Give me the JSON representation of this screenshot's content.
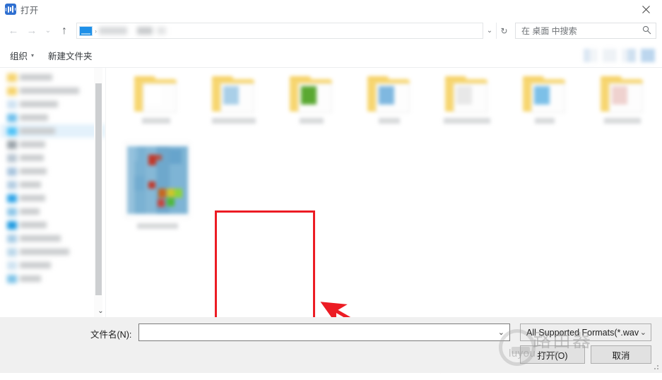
{
  "window": {
    "title": "打开",
    "app_icon": "audio-waveform-icon",
    "close_label": "✕"
  },
  "nav": {
    "back_icon": "arrow-left-icon",
    "forward_icon": "arrow-right-icon",
    "recent_icon": "chevron-down-icon",
    "up_icon": "arrow-up-icon",
    "breadcrumb_icon": "desktop-monitor-icon",
    "breadcrumb_separator": "›",
    "path_dropdown_icon": "chevron-down-icon",
    "refresh_icon": "↻",
    "search": {
      "placeholder": "在 桌面 中搜索",
      "icon": "search-icon"
    }
  },
  "command_bar": {
    "organize_label": "组织",
    "organize_caret": "▾",
    "new_folder_label": "新建文件夹",
    "view_buttons": [
      "view-mode-button-1",
      "view-mode-button-2",
      "view-mode-button-3",
      "help-button"
    ]
  },
  "sidebar": {
    "scroll_down_icon": "chevron-down-icon",
    "items": [
      {
        "icon_color": "#f6d36b",
        "label_width": 46,
        "selected": false
      },
      {
        "icon_color": "#f6d36b",
        "label_width": 84,
        "selected": false
      },
      {
        "icon_color": "#cfe2f2",
        "label_width": 54,
        "selected": false
      },
      {
        "icon_color": "#6fc0ec",
        "label_width": 40,
        "selected": false
      },
      {
        "icon_color": "#4fc3f7",
        "label_width": 50,
        "selected": true
      },
      {
        "icon_color": "#9aa3aa",
        "label_width": 36,
        "selected": false
      },
      {
        "icon_color": "#b9c6d2",
        "label_width": 34,
        "selected": false
      },
      {
        "icon_color": "#a8c4dd",
        "label_width": 38,
        "selected": false
      },
      {
        "icon_color": "#b4cde2",
        "label_width": 30,
        "selected": false
      },
      {
        "icon_color": "#2fa4e7",
        "label_width": 36,
        "selected": false
      },
      {
        "icon_color": "#8fc7e8",
        "label_width": 28,
        "selected": false
      },
      {
        "icon_color": "#1e9ae0",
        "label_width": 38,
        "selected": false
      },
      {
        "icon_color": "#a9cde6",
        "label_width": 58,
        "selected": false
      },
      {
        "icon_color": "#bcd8ea",
        "label_width": 70,
        "selected": false
      },
      {
        "icon_color": "#cfe3f1",
        "label_width": 44,
        "selected": false
      },
      {
        "icon_color": "#7fc4e8",
        "label_width": 30,
        "selected": false
      }
    ]
  },
  "files": {
    "folders": [
      {
        "name": "folder-item",
        "accent": "#ffffff",
        "caption_width": 40
      },
      {
        "name": "folder-item",
        "accent": "#a9cfe8",
        "caption_width": 62
      },
      {
        "name": "folder-item",
        "accent": "#5aa832",
        "caption_width": 34
      },
      {
        "name": "folder-item",
        "accent": "#7fb8e0",
        "caption_width": 30
      },
      {
        "name": "folder-item",
        "accent": "#e8e8e8",
        "caption_width": 66
      },
      {
        "name": "folder-item",
        "accent": "#7cc0e8",
        "caption_width": 28
      },
      {
        "name": "folder-item",
        "accent": "#efd2cf",
        "caption_width": 52
      }
    ],
    "highlighted_item": {
      "name": "image-thumbnail-item",
      "caption_width": 58,
      "highlight_color": "#ec1c24"
    }
  },
  "annotation": {
    "arrow_color": "#ec1c24",
    "arrow_name": "red-pointer-arrow"
  },
  "footer": {
    "filename_label": "文件名(N):",
    "filename_value": "",
    "filename_placeholder": "",
    "filename_dropdown_icon": "chevron-down-icon",
    "filter_value": "All Supported Formats(*.wav",
    "filter_dropdown_icon": "chevron-down-icon",
    "open_button": "打开(O)",
    "cancel_button": "取消",
    "resize_grip": "resize-grip-icon"
  },
  "watermark": {
    "text": "路由器",
    "subtext": "luyou.com"
  }
}
